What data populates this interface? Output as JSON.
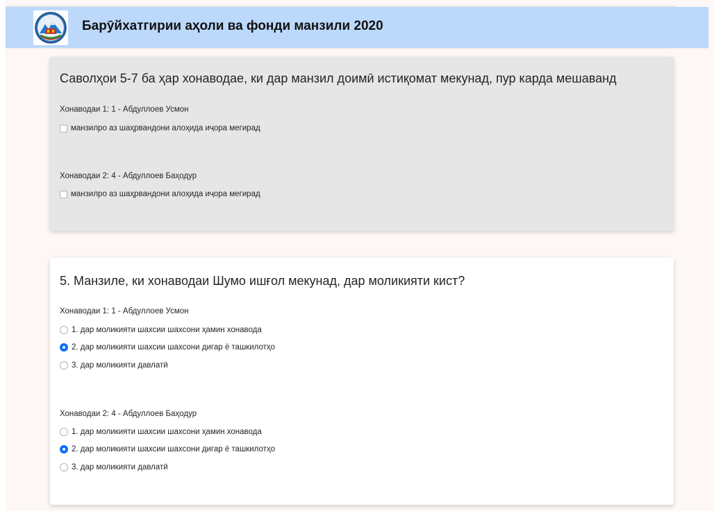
{
  "header": {
    "title": "Барӯйхатгирии аҳоли ва фонди манзили 2020",
    "logo_icon": "census-emblem-icon"
  },
  "section_intro": {
    "heading": "Саволҳои 5-7 ба ҳар хонаводае, ки дар манзил доимӣ истиқомат мекунад, пур карда мешаванд",
    "households": [
      {
        "label": "Хонаводаи 1: 1 - Абдуллоев Усмон",
        "checkbox_label": "манзилро аз шаҳрвандони алоҳида иҷора мегирад",
        "checked": false
      },
      {
        "label": "Хонаводаи 2: 4 - Абдуллоев Баҳодур",
        "checkbox_label": "манзилро аз шаҳрвандони алоҳида иҷора мегирад",
        "checked": false
      }
    ]
  },
  "question5": {
    "heading": "5. Манзиле, ки хонаводаи Шумо ишғол мекунад, дар моликияти кист?",
    "households": [
      {
        "label": "Хонаводаи 1: 1 - Абдуллоев Усмон",
        "options": [
          "1. дар моликияти шахсии шахсони ҳамин хонавода",
          "2. дар моликияти шахсии шахсони дигар ё ташкилотҳо",
          "3. дар моликияти давлатӣ"
        ],
        "selected": 2
      },
      {
        "label": "Хонаводаи 2: 4 - Абдуллоев Баҳодур",
        "options": [
          "1. дар моликияти шахсии шахсони ҳамин хонавода",
          "2. дар моликияти шахсии шахсони дигар ё ташкилотҳо",
          "3. дар моликияти давлатӣ"
        ],
        "selected": 2
      }
    ]
  },
  "colors": {
    "header_bg": "#bcd9fb",
    "page_bg": "#fdf7f6",
    "accent": "#0d6efd"
  }
}
